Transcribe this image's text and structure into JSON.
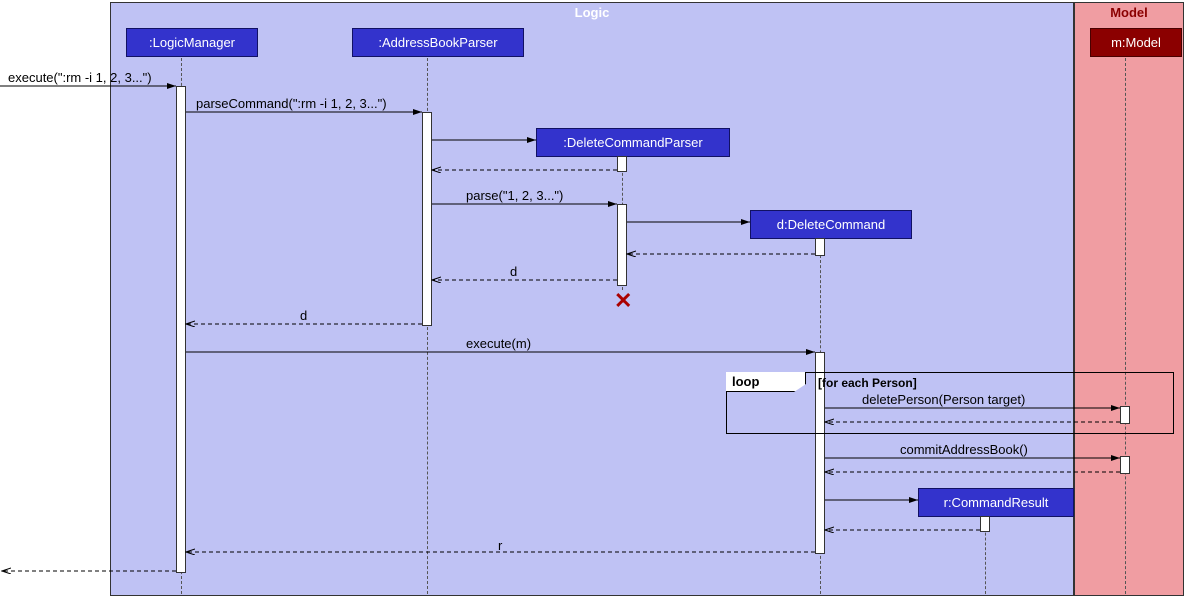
{
  "regions": {
    "logic": "Logic",
    "model": "Model"
  },
  "participants": {
    "logicManager": ":LogicManager",
    "addressBookParser": ":AddressBookParser",
    "deleteCommandParser": ":DeleteCommandParser",
    "deleteCommand": "d:DeleteCommand",
    "commandResult": "r:CommandResult",
    "model": "m:Model"
  },
  "messages": {
    "execute": "execute(\":rm -i 1, 2, 3...\")",
    "parseCommand": "parseCommand(\":rm -i 1, 2, 3...\")",
    "parse": "parse(\"1, 2, 3...\")",
    "returnD1": "d",
    "returnD2": "d",
    "executeM": "execute(m)",
    "deletePerson": "deletePerson(Person target)",
    "commitAB": "commitAddressBook()",
    "returnR": "r"
  },
  "loop": {
    "label": "loop",
    "condition": "[for each Person]"
  },
  "chart_data": {
    "type": "sequence-diagram",
    "boxes": [
      {
        "name": "Logic",
        "participants": [
          ":LogicManager",
          ":AddressBookParser",
          ":DeleteCommandParser",
          "d:DeleteCommand",
          "r:CommandResult"
        ]
      },
      {
        "name": "Model",
        "participants": [
          "m:Model"
        ]
      }
    ],
    "messages": [
      {
        "from": "external",
        "to": ":LogicManager",
        "label": "execute(\":rm -i 1, 2, 3...\")",
        "kind": "sync"
      },
      {
        "from": ":LogicManager",
        "to": ":AddressBookParser",
        "label": "parseCommand(\":rm -i 1, 2, 3...\")",
        "kind": "sync"
      },
      {
        "from": ":AddressBookParser",
        "to": ":DeleteCommandParser",
        "label": "",
        "kind": "create"
      },
      {
        "from": ":DeleteCommandParser",
        "to": ":AddressBookParser",
        "label": "",
        "kind": "return"
      },
      {
        "from": ":AddressBookParser",
        "to": ":DeleteCommandParser",
        "label": "parse(\"1, 2, 3...\")",
        "kind": "sync"
      },
      {
        "from": ":DeleteCommandParser",
        "to": "d:DeleteCommand",
        "label": "",
        "kind": "create"
      },
      {
        "from": "d:DeleteCommand",
        "to": ":DeleteCommandParser",
        "label": "",
        "kind": "return"
      },
      {
        "from": ":DeleteCommandParser",
        "to": ":AddressBookParser",
        "label": "d",
        "kind": "return"
      },
      {
        "from": ":DeleteCommandParser",
        "to": "destroy",
        "label": "",
        "kind": "destroy"
      },
      {
        "from": ":AddressBookParser",
        "to": ":LogicManager",
        "label": "d",
        "kind": "return"
      },
      {
        "from": ":LogicManager",
        "to": "d:DeleteCommand",
        "label": "execute(m)",
        "kind": "sync"
      },
      {
        "loop": "[for each Person]",
        "messages": [
          {
            "from": "d:DeleteCommand",
            "to": "m:Model",
            "label": "deletePerson(Person target)",
            "kind": "sync"
          },
          {
            "from": "m:Model",
            "to": "d:DeleteCommand",
            "label": "",
            "kind": "return"
          }
        ]
      },
      {
        "from": "d:DeleteCommand",
        "to": "m:Model",
        "label": "commitAddressBook()",
        "kind": "sync"
      },
      {
        "from": "m:Model",
        "to": "d:DeleteCommand",
        "label": "",
        "kind": "return"
      },
      {
        "from": "d:DeleteCommand",
        "to": "r:CommandResult",
        "label": "",
        "kind": "create"
      },
      {
        "from": "r:CommandResult",
        "to": "d:DeleteCommand",
        "label": "",
        "kind": "return"
      },
      {
        "from": "d:DeleteCommand",
        "to": ":LogicManager",
        "label": "r",
        "kind": "return"
      },
      {
        "from": ":LogicManager",
        "to": "external",
        "label": "",
        "kind": "return"
      }
    ]
  }
}
